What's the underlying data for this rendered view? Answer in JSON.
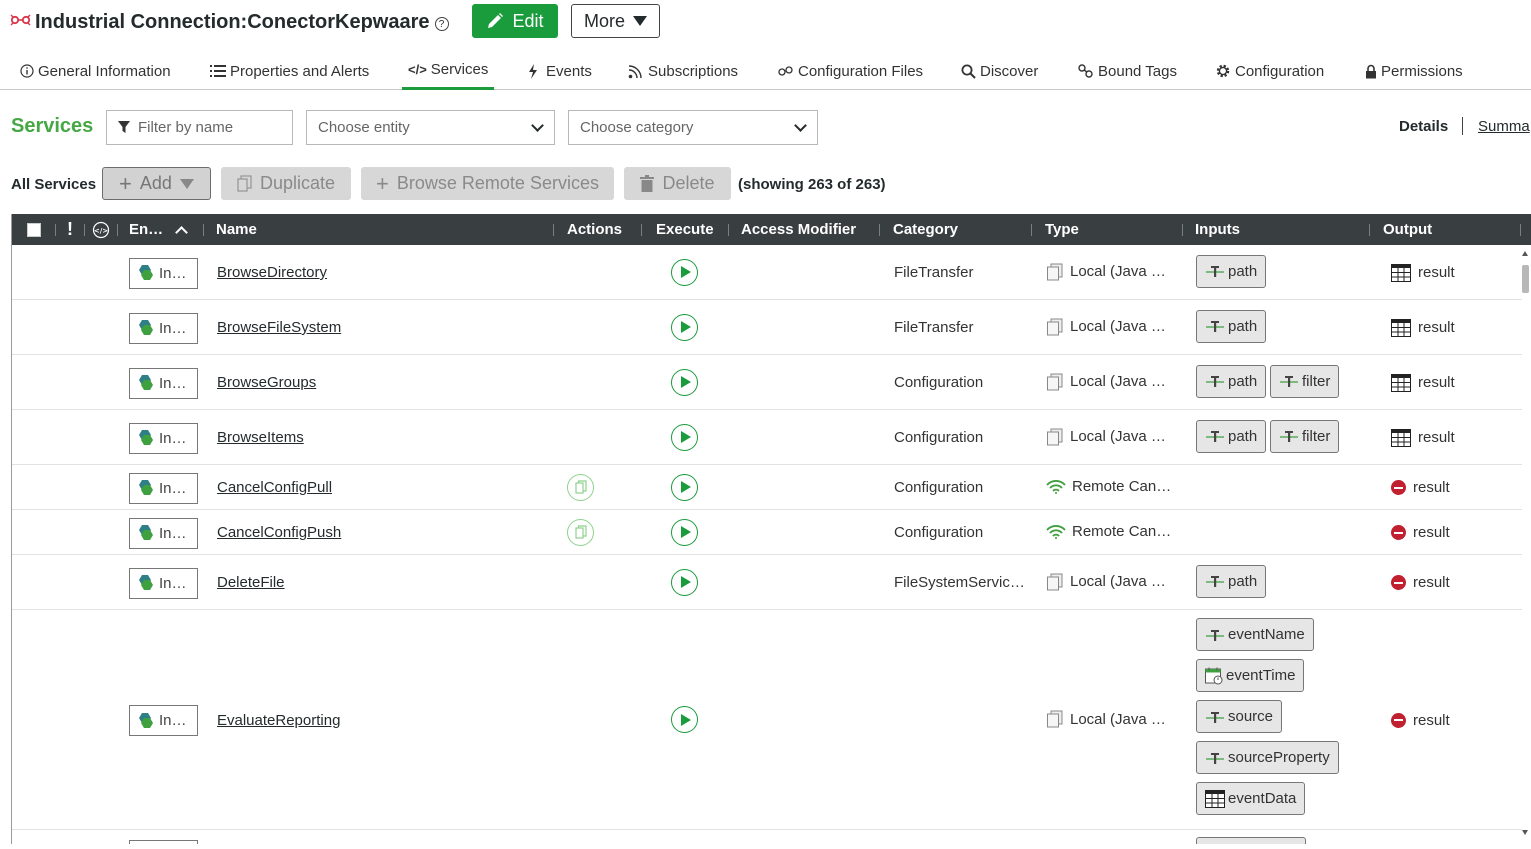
{
  "header": {
    "title": "Industrial Connection:ConectorKepwaare",
    "help_glyph": "?",
    "edit_label": "Edit",
    "more_label": "More"
  },
  "tabs": [
    {
      "label": "General Information",
      "icon": "info-icon"
    },
    {
      "label": "Properties and Alerts",
      "icon": "list-icon"
    },
    {
      "label": "Services",
      "icon": "code-icon",
      "active": true
    },
    {
      "label": "Events",
      "icon": "bolt-icon"
    },
    {
      "label": "Subscriptions",
      "icon": "rss-icon"
    },
    {
      "label": "Configuration Files",
      "icon": "link-icon"
    },
    {
      "label": "Discover",
      "icon": "search-icon"
    },
    {
      "label": "Bound Tags",
      "icon": "tags-icon"
    },
    {
      "label": "Configuration",
      "icon": "gear-icon"
    },
    {
      "label": "Permissions",
      "icon": "lock-icon"
    }
  ],
  "services": {
    "title": "Services",
    "filter_placeholder": "Filter by name",
    "entity_placeholder": "Choose entity",
    "category_placeholder": "Choose category",
    "details_label": "Details",
    "summary_label": "Summa"
  },
  "toolbar": {
    "all_services": "All Services",
    "add": "Add",
    "duplicate": "Duplicate",
    "browse_remote": "Browse Remote Services",
    "delete": "Delete",
    "showing": "(showing 263 of 263)"
  },
  "table": {
    "headers": {
      "exclaim": "!",
      "entity": "En…",
      "name": "Name",
      "actions": "Actions",
      "execute": "Execute",
      "access_modifier": "Access Modifier",
      "category": "Category",
      "type": "Type",
      "inputs": "Inputs",
      "output": "Output"
    },
    "rows": [
      {
        "entity": "In…",
        "name": "BrowseDirectory",
        "action": false,
        "category": "FileTransfer",
        "type": "Local (Java …",
        "type_icon": "local",
        "inputs": [
          {
            "label": "path",
            "icon": "text"
          }
        ],
        "output": "result",
        "output_icon": "table"
      },
      {
        "entity": "In…",
        "name": "BrowseFileSystem",
        "action": false,
        "category": "FileTransfer",
        "type": "Local (Java …",
        "type_icon": "local",
        "inputs": [
          {
            "label": "path",
            "icon": "text"
          }
        ],
        "output": "result",
        "output_icon": "table"
      },
      {
        "entity": "In…",
        "name": "BrowseGroups",
        "action": false,
        "category": "Configuration",
        "type": "Local (Java …",
        "type_icon": "local",
        "inputs": [
          {
            "label": "path",
            "icon": "text"
          },
          {
            "label": "filter",
            "icon": "text"
          }
        ],
        "output": "result",
        "output_icon": "table"
      },
      {
        "entity": "In…",
        "name": "BrowseItems",
        "action": false,
        "category": "Configuration",
        "type": "Local (Java …",
        "type_icon": "local",
        "inputs": [
          {
            "label": "path",
            "icon": "text"
          },
          {
            "label": "filter",
            "icon": "text"
          }
        ],
        "output": "result",
        "output_icon": "table"
      },
      {
        "entity": "In…",
        "name": "CancelConfigPull",
        "action": true,
        "category": "Configuration",
        "type": "Remote Can…",
        "type_icon": "remote",
        "inputs": [],
        "output": "result",
        "output_icon": "nothing"
      },
      {
        "entity": "In…",
        "name": "CancelConfigPush",
        "action": true,
        "category": "Configuration",
        "type": "Remote Can…",
        "type_icon": "remote",
        "inputs": [],
        "output": "result",
        "output_icon": "nothing"
      },
      {
        "entity": "In…",
        "name": "DeleteFile",
        "action": false,
        "category": "FileSystemServic…",
        "type": "Local (Java …",
        "type_icon": "local",
        "inputs": [
          {
            "label": "path",
            "icon": "text"
          }
        ],
        "output": "result",
        "output_icon": "nothing"
      },
      {
        "entity": "In…",
        "name": "EvaluateReporting",
        "action": false,
        "category": "",
        "type": "Local (Java …",
        "type_icon": "local",
        "inputs": [
          {
            "label": "eventName",
            "icon": "text"
          },
          {
            "label": "eventTime",
            "icon": "datetime"
          },
          {
            "label": "source",
            "icon": "text"
          },
          {
            "label": "sourceProperty",
            "icon": "text"
          },
          {
            "label": "eventData",
            "icon": "table"
          }
        ],
        "output": "result",
        "output_icon": "nothing"
      }
    ]
  },
  "colors": {
    "accent_green": "#1a9c3c",
    "services_title": "#45a845",
    "header_bg": "#393f41",
    "nothing_red": "#c0202f"
  }
}
